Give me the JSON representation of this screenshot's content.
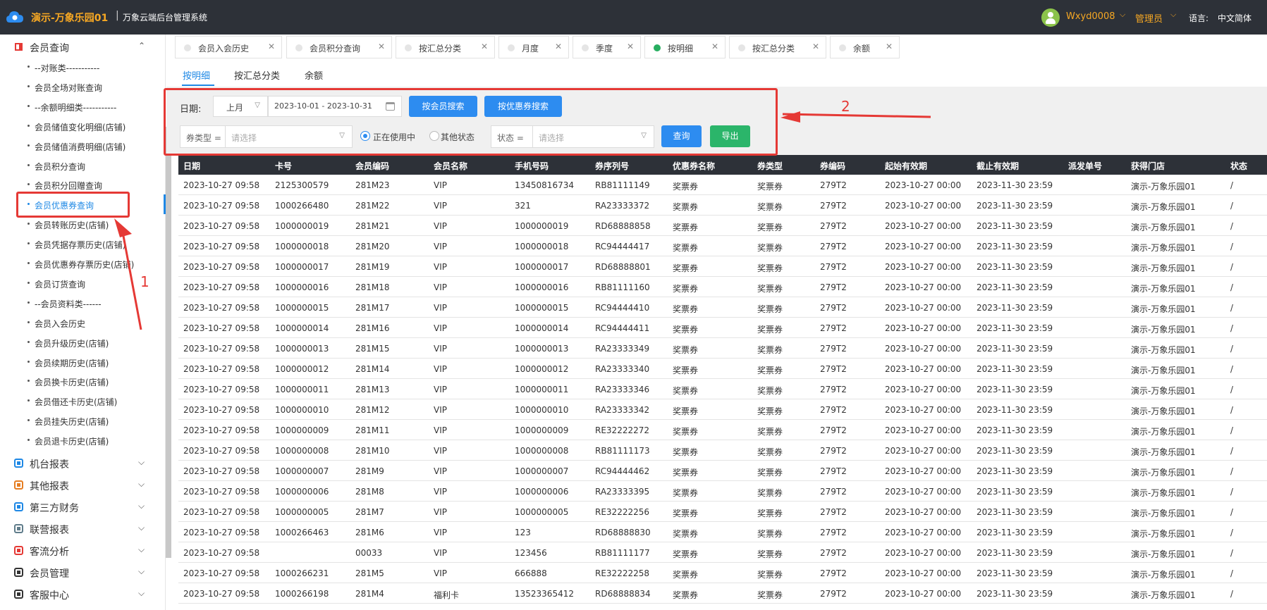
{
  "header": {
    "app_name": "演示-万象乐园01",
    "separator": "|",
    "system_name": "万象云端后台管理系统",
    "user": "Wxyd0008",
    "role": "管理员",
    "lang_label": "语言:",
    "lang_value": "中文简体",
    "accent_color": "#f7a823"
  },
  "sidebar": {
    "top_group": "会员查询",
    "items": [
      "--对账类-----------",
      "会员全场对账查询",
      "--余额明细类-----------",
      "会员储值变化明细(店铺)",
      "会员储值消费明细(店铺)",
      "会员积分查询",
      "会员积分回赠查询",
      "会员优惠券查询",
      "会员转账历史(店铺)",
      "会员凭据存票历史(店铺)",
      "会员优惠券存票历史(店铺)",
      "会员订货查询",
      "--会员资料类------",
      "会员入会历史",
      "会员升级历史(店铺)",
      "会员续期历史(店铺)",
      "会员换卡历史(店铺)",
      "会员借还卡历史(店铺)",
      "会员挂失历史(店铺)",
      "会员退卡历史(店铺)"
    ],
    "active_index": 7,
    "groups": [
      "机台报表",
      "其他报表",
      "第三方财务",
      "联营报表",
      "客流分析",
      "会员管理",
      "客服中心"
    ]
  },
  "tabs": [
    {
      "label": "会员入会历史",
      "active": false
    },
    {
      "label": "会员积分查询",
      "active": false
    },
    {
      "label": "按汇总分类",
      "active": false
    },
    {
      "label": "月度",
      "active": false
    },
    {
      "label": "季度",
      "active": false
    },
    {
      "label": "按明细",
      "active": true
    },
    {
      "label": "按汇总分类",
      "active": false
    },
    {
      "label": "余额",
      "active": false
    }
  ],
  "subtabs": [
    "按明细",
    "按汇总分类",
    "余额"
  ],
  "filters": {
    "date_label": "日期:",
    "period": "上月",
    "date_range": "2023-10-01 - 2023-10-31",
    "btn_member_search": "按会员搜索",
    "btn_coupon_search": "按优惠券搜索",
    "coupon_type_label": "券类型 =",
    "coupon_type_placeholder": "请选择",
    "radio_in_use": "正在使用中",
    "radio_other": "其他状态",
    "status_label": "状态 =",
    "status_placeholder": "请选择",
    "btn_query": "查询",
    "btn_export": "导出"
  },
  "annotations": {
    "label1": "1",
    "label2": "2"
  },
  "table": {
    "headers": [
      "日期",
      "卡号",
      "会员编码",
      "会员名称",
      "手机号码",
      "券序列号",
      "优惠券名称",
      "券类型",
      "券编码",
      "起始有效期",
      "截止有效期",
      "派发单号",
      "获得门店",
      "状态"
    ],
    "rows": [
      [
        "2023-10-27 09:58",
        "2125300579",
        "281M23",
        "VIP",
        "13450816734",
        "RB81111149",
        "奖票券",
        "奖票券",
        "279T2",
        "2023-10-27 00:00",
        "2023-11-30 23:59",
        "",
        "演示-万象乐园01",
        "/"
      ],
      [
        "2023-10-27 09:58",
        "1000266480",
        "281M22",
        "VIP",
        "321",
        "RA23333372",
        "奖票券",
        "奖票券",
        "279T2",
        "2023-10-27 00:00",
        "2023-11-30 23:59",
        "",
        "演示-万象乐园01",
        "/"
      ],
      [
        "2023-10-27 09:58",
        "1000000019",
        "281M21",
        "VIP",
        "1000000019",
        "RD68888858",
        "奖票券",
        "奖票券",
        "279T2",
        "2023-10-27 00:00",
        "2023-11-30 23:59",
        "",
        "演示-万象乐园01",
        "/"
      ],
      [
        "2023-10-27 09:58",
        "1000000018",
        "281M20",
        "VIP",
        "1000000018",
        "RC94444417",
        "奖票券",
        "奖票券",
        "279T2",
        "2023-10-27 00:00",
        "2023-11-30 23:59",
        "",
        "演示-万象乐园01",
        "/"
      ],
      [
        "2023-10-27 09:58",
        "1000000017",
        "281M19",
        "VIP",
        "1000000017",
        "RD68888801",
        "奖票券",
        "奖票券",
        "279T2",
        "2023-10-27 00:00",
        "2023-11-30 23:59",
        "",
        "演示-万象乐园01",
        "/"
      ],
      [
        "2023-10-27 09:58",
        "1000000016",
        "281M18",
        "VIP",
        "1000000016",
        "RB81111160",
        "奖票券",
        "奖票券",
        "279T2",
        "2023-10-27 00:00",
        "2023-11-30 23:59",
        "",
        "演示-万象乐园01",
        "/"
      ],
      [
        "2023-10-27 09:58",
        "1000000015",
        "281M17",
        "VIP",
        "1000000015",
        "RC94444410",
        "奖票券",
        "奖票券",
        "279T2",
        "2023-10-27 00:00",
        "2023-11-30 23:59",
        "",
        "演示-万象乐园01",
        "/"
      ],
      [
        "2023-10-27 09:58",
        "1000000014",
        "281M16",
        "VIP",
        "1000000014",
        "RC94444411",
        "奖票券",
        "奖票券",
        "279T2",
        "2023-10-27 00:00",
        "2023-11-30 23:59",
        "",
        "演示-万象乐园01",
        "/"
      ],
      [
        "2023-10-27 09:58",
        "1000000013",
        "281M15",
        "VIP",
        "1000000013",
        "RA23333349",
        "奖票券",
        "奖票券",
        "279T2",
        "2023-10-27 00:00",
        "2023-11-30 23:59",
        "",
        "演示-万象乐园01",
        "/"
      ],
      [
        "2023-10-27 09:58",
        "1000000012",
        "281M14",
        "VIP",
        "1000000012",
        "RA23333340",
        "奖票券",
        "奖票券",
        "279T2",
        "2023-10-27 00:00",
        "2023-11-30 23:59",
        "",
        "演示-万象乐园01",
        "/"
      ],
      [
        "2023-10-27 09:58",
        "1000000011",
        "281M13",
        "VIP",
        "1000000011",
        "RA23333346",
        "奖票券",
        "奖票券",
        "279T2",
        "2023-10-27 00:00",
        "2023-11-30 23:59",
        "",
        "演示-万象乐园01",
        "/"
      ],
      [
        "2023-10-27 09:58",
        "1000000010",
        "281M12",
        "VIP",
        "1000000010",
        "RA23333342",
        "奖票券",
        "奖票券",
        "279T2",
        "2023-10-27 00:00",
        "2023-11-30 23:59",
        "",
        "演示-万象乐园01",
        "/"
      ],
      [
        "2023-10-27 09:58",
        "1000000009",
        "281M11",
        "VIP",
        "1000000009",
        "RE32222272",
        "奖票券",
        "奖票券",
        "279T2",
        "2023-10-27 00:00",
        "2023-11-30 23:59",
        "",
        "演示-万象乐园01",
        "/"
      ],
      [
        "2023-10-27 09:58",
        "1000000008",
        "281M10",
        "VIP",
        "1000000008",
        "RB81111173",
        "奖票券",
        "奖票券",
        "279T2",
        "2023-10-27 00:00",
        "2023-11-30 23:59",
        "",
        "演示-万象乐园01",
        "/"
      ],
      [
        "2023-10-27 09:58",
        "1000000007",
        "281M9",
        "VIP",
        "1000000007",
        "RC94444462",
        "奖票券",
        "奖票券",
        "279T2",
        "2023-10-27 00:00",
        "2023-11-30 23:59",
        "",
        "演示-万象乐园01",
        "/"
      ],
      [
        "2023-10-27 09:58",
        "1000000006",
        "281M8",
        "VIP",
        "1000000006",
        "RA23333395",
        "奖票券",
        "奖票券",
        "279T2",
        "2023-10-27 00:00",
        "2023-11-30 23:59",
        "",
        "演示-万象乐园01",
        "/"
      ],
      [
        "2023-10-27 09:58",
        "1000000005",
        "281M7",
        "VIP",
        "1000000005",
        "RE32222256",
        "奖票券",
        "奖票券",
        "279T2",
        "2023-10-27 00:00",
        "2023-11-30 23:59",
        "",
        "演示-万象乐园01",
        "/"
      ],
      [
        "2023-10-27 09:58",
        "1000266463",
        "281M6",
        "VIP",
        "123",
        "RD68888830",
        "奖票券",
        "奖票券",
        "279T2",
        "2023-10-27 00:00",
        "2023-11-30 23:59",
        "",
        "演示-万象乐园01",
        "/"
      ],
      [
        "2023-10-27 09:58",
        "",
        "00033",
        "VIP",
        "123456",
        "RB81111177",
        "奖票券",
        "奖票券",
        "279T2",
        "2023-10-27 00:00",
        "2023-11-30 23:59",
        "",
        "演示-万象乐园01",
        "/"
      ],
      [
        "2023-10-27 09:58",
        "1000266231",
        "281M5",
        "VIP",
        "666888",
        "RE32222258",
        "奖票券",
        "奖票券",
        "279T2",
        "2023-10-27 00:00",
        "2023-11-30 23:59",
        "",
        "演示-万象乐园01",
        "/"
      ],
      [
        "2023-10-27 09:58",
        "1000266198",
        "281M4",
        "福利卡",
        "13523365412",
        "RD68888834",
        "奖票券",
        "奖票券",
        "279T2",
        "2023-10-27 00:00",
        "2023-11-30 23:59",
        "",
        "演示-万象乐园01",
        "/"
      ]
    ]
  }
}
